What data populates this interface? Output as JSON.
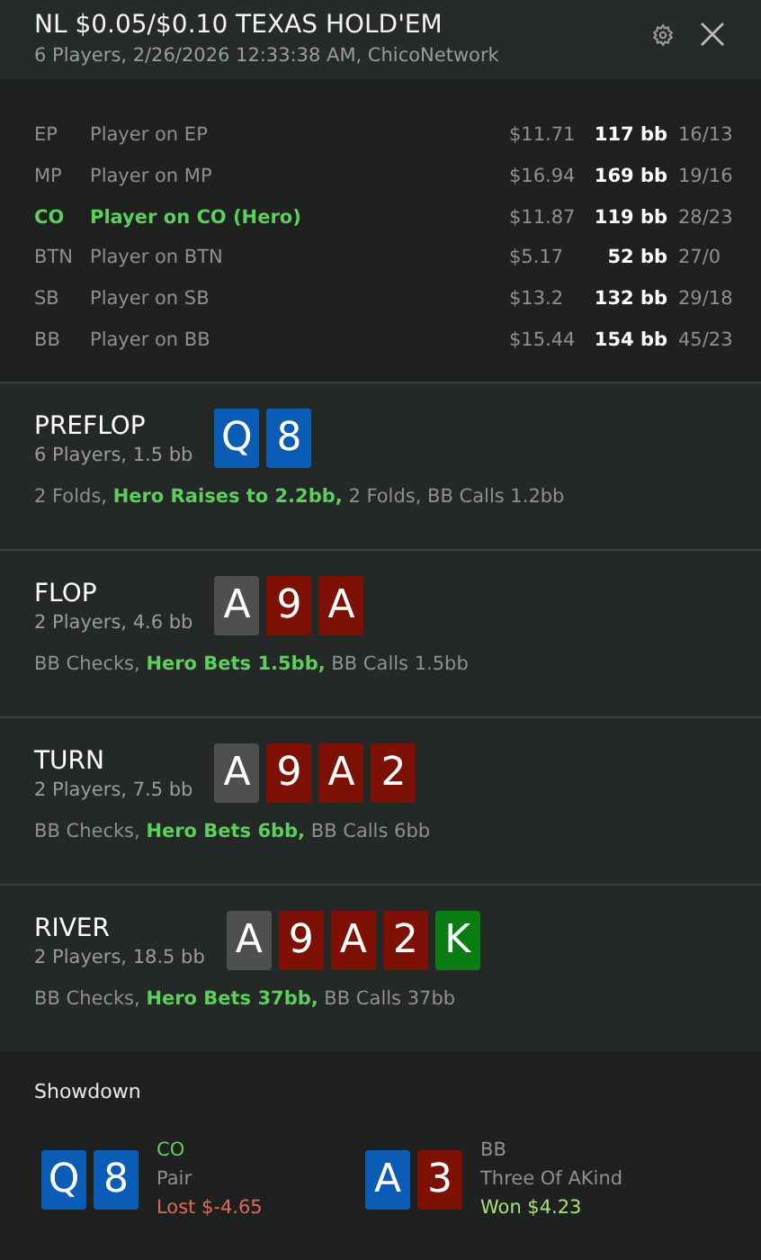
{
  "header": {
    "title": "NL $0.05/$0.10 TEXAS HOLD'EM",
    "subtitle": "6 Players, 2/26/2026 12:33:38 AM, ChicoNetwork"
  },
  "players": [
    {
      "position": "EP",
      "name": "Player on EP",
      "stack": "$11.71",
      "bb": "117 bb",
      "stats": "16/13",
      "hero": false
    },
    {
      "position": "MP",
      "name": "Player on MP",
      "stack": "$16.94",
      "bb": "169 bb",
      "stats": "19/16",
      "hero": false
    },
    {
      "position": "CO",
      "name": "Player on CO (Hero)",
      "stack": "$11.87",
      "bb": "119 bb",
      "stats": "28/23",
      "hero": true
    },
    {
      "position": "BTN",
      "name": "Player on BTN",
      "stack": "$5.17",
      "bb": "52 bb",
      "stats": "27/0",
      "hero": false
    },
    {
      "position": "SB",
      "name": "Player on SB",
      "stack": "$13.2",
      "bb": "132 bb",
      "stats": "29/18",
      "hero": false
    },
    {
      "position": "BB",
      "name": "Player on BB",
      "stack": "$15.44",
      "bb": "154 bb",
      "stats": "45/23",
      "hero": false
    }
  ],
  "streets": [
    {
      "name": "PREFLOP",
      "info": "6 Players, 1.5 bb",
      "cards": [
        {
          "rank": "Q",
          "color": "#0a5cb5"
        },
        {
          "rank": "8",
          "color": "#0a5cb5"
        }
      ],
      "actions": "2 Folds, **Hero Raises to 2.2bb,** 2 Folds, BB Calls 1.2bb"
    },
    {
      "name": "FLOP",
      "info": "2 Players, 4.6 bb",
      "cards": [
        {
          "rank": "A",
          "color": "#4f4f4f"
        },
        {
          "rank": "9",
          "color": "#7d1106"
        },
        {
          "rank": "A",
          "color": "#7d1106"
        }
      ],
      "actions": "BB Checks, **Hero Bets 1.5bb,** BB Calls 1.5bb"
    },
    {
      "name": "TURN",
      "info": "2 Players, 7.5 bb",
      "cards": [
        {
          "rank": "A",
          "color": "#4f4f4f"
        },
        {
          "rank": "9",
          "color": "#7d1106"
        },
        {
          "rank": "A",
          "color": "#7d1106"
        },
        {
          "rank": "2",
          "color": "#7d1106"
        }
      ],
      "actions": "BB Checks, **Hero Bets 6bb,** BB Calls 6bb"
    },
    {
      "name": "RIVER",
      "info": "2 Players, 18.5 bb",
      "cards": [
        {
          "rank": "A",
          "color": "#4f4f4f"
        },
        {
          "rank": "9",
          "color": "#7d1106"
        },
        {
          "rank": "A",
          "color": "#7d1106"
        },
        {
          "rank": "2",
          "color": "#7d1106"
        },
        {
          "rank": "K",
          "color": "#0a7d12"
        }
      ],
      "actions": "BB Checks, **Hero Bets 37bb,** BB Calls 37bb"
    }
  ],
  "showdown": {
    "title": "Showdown",
    "hands": [
      {
        "cards": [
          {
            "rank": "Q",
            "color": "#0a5cb5"
          },
          {
            "rank": "8",
            "color": "#0a5cb5"
          }
        ],
        "position": "CO",
        "hero": true,
        "hand": "Pair",
        "result": "Lost $-4.65",
        "won": false
      },
      {
        "cards": [
          {
            "rank": "A",
            "color": "#0a5cb5"
          },
          {
            "rank": "3",
            "color": "#7d1106"
          }
        ],
        "position": "BB",
        "hero": false,
        "hand": "Three Of AKind",
        "result": "Won $4.23",
        "won": true
      }
    ]
  }
}
